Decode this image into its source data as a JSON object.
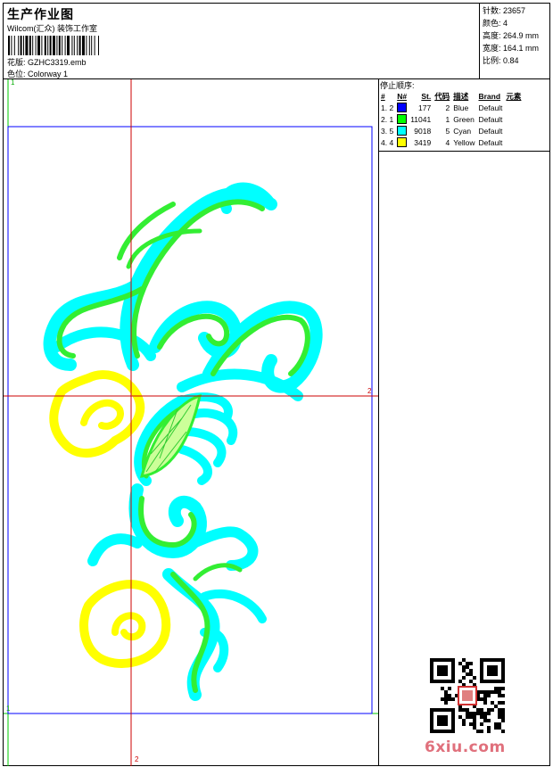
{
  "header": {
    "title": "生产作业图",
    "studio": "Wilcom(汇众) 装饰工作室",
    "design_label": "花版:",
    "design_value": "GZHC3319.emb",
    "colorway_label": "色位:",
    "colorway_value": "Colorway 1"
  },
  "stats": [
    {
      "label": "针数:",
      "value": "23657"
    },
    {
      "label": "颜色:",
      "value": "4"
    },
    {
      "label": "高度:",
      "value": "264.9 mm"
    },
    {
      "label": "宽度:",
      "value": "164.1 mm"
    },
    {
      "label": "比例:",
      "value": "0.84"
    }
  ],
  "stop_sequence": {
    "title": "停止顺序:",
    "headers": [
      "#",
      "N#",
      "St.",
      "代码",
      "描述",
      "Brand",
      "元素"
    ],
    "rows": [
      {
        "idx": "1. 2",
        "color": "#0000ff",
        "st": "177",
        "code": "2",
        "desc": "Blue",
        "brand": "Default",
        "elem": ""
      },
      {
        "idx": "2. 1",
        "color": "#00ff00",
        "st": "11041",
        "code": "1",
        "desc": "Green",
        "brand": "Default",
        "elem": ""
      },
      {
        "idx": "3. 5",
        "color": "#00ffff",
        "st": "9018",
        "code": "5",
        "desc": "Cyan",
        "brand": "Default",
        "elem": ""
      },
      {
        "idx": "4. 4",
        "color": "#ffff00",
        "st": "3419",
        "code": "4",
        "desc": "Yellow",
        "brand": "Default",
        "elem": ""
      }
    ]
  },
  "guides": {
    "top_marker": "1",
    "bottom_left_marker": "1",
    "right_marker": "2",
    "bottom_marker": "2"
  },
  "watermark": {
    "site": "6xiu.com"
  },
  "colors": {
    "cyan": "#00ffff",
    "green": "#33ee33",
    "yellow": "#ffff00",
    "blue": "#0000ff",
    "crosshair": "#cc0000",
    "guide_green": "#00cc00"
  }
}
